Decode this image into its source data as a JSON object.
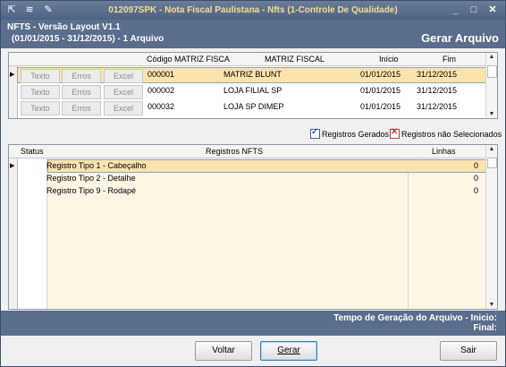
{
  "window": {
    "title": "012097SPK - Nota Fiscal Paulistana - Nfts (1-Controle De Qualidade)",
    "controls": [
      "_",
      "□",
      "✕"
    ]
  },
  "header": {
    "line1": "NFTS - Versão Layout V1.1",
    "line2": "(01/01/2015 - 31/12/2015) - 1 Arquivo",
    "action_title": "Gerar Arquivo"
  },
  "files_grid": {
    "columns": [
      "Código MATRIZ FISCA",
      "MATRIZ FISCAL",
      "Início",
      "Fim"
    ],
    "row_buttons": [
      "Texto",
      "Erros",
      "Excel"
    ],
    "rows": [
      {
        "codigo": "000001",
        "matriz": "MATRIZ BLUNT",
        "inicio": "01/01/2015",
        "fim": "31/12/2015"
      },
      {
        "codigo": "000002",
        "matriz": "LOJA FILIAL SP",
        "inicio": "01/01/2015",
        "fim": "31/12/2015"
      },
      {
        "codigo": "000032",
        "matriz": "LOJA SP DIMEP",
        "inicio": "01/01/2015",
        "fim": "31/12/2015"
      }
    ]
  },
  "legend": {
    "generated": "Registros Gerados",
    "not_selected": "Registros não Selecionados"
  },
  "records_grid": {
    "columns": [
      "Status",
      "Registros NFTS",
      "Linhas"
    ],
    "rows": [
      {
        "label": "Registro Tipo 1 - Cabeçalho",
        "lines": "0"
      },
      {
        "label": "Registro Tipo 2 - Detalhe",
        "lines": "0"
      },
      {
        "label": "Registro Tipo 9 - Rodapé",
        "lines": "0"
      }
    ]
  },
  "footer": {
    "time_label": "Tempo de Geração do Arquivo - Inicio:",
    "end_label": "Final:"
  },
  "buttons": {
    "back": "Voltar",
    "generate": "Gerar",
    "exit": "Sair"
  },
  "colors": {
    "header_bg": "#5a6d8c",
    "selected_row": "#fbe3ae",
    "row_bg": "#fdf5e3"
  }
}
